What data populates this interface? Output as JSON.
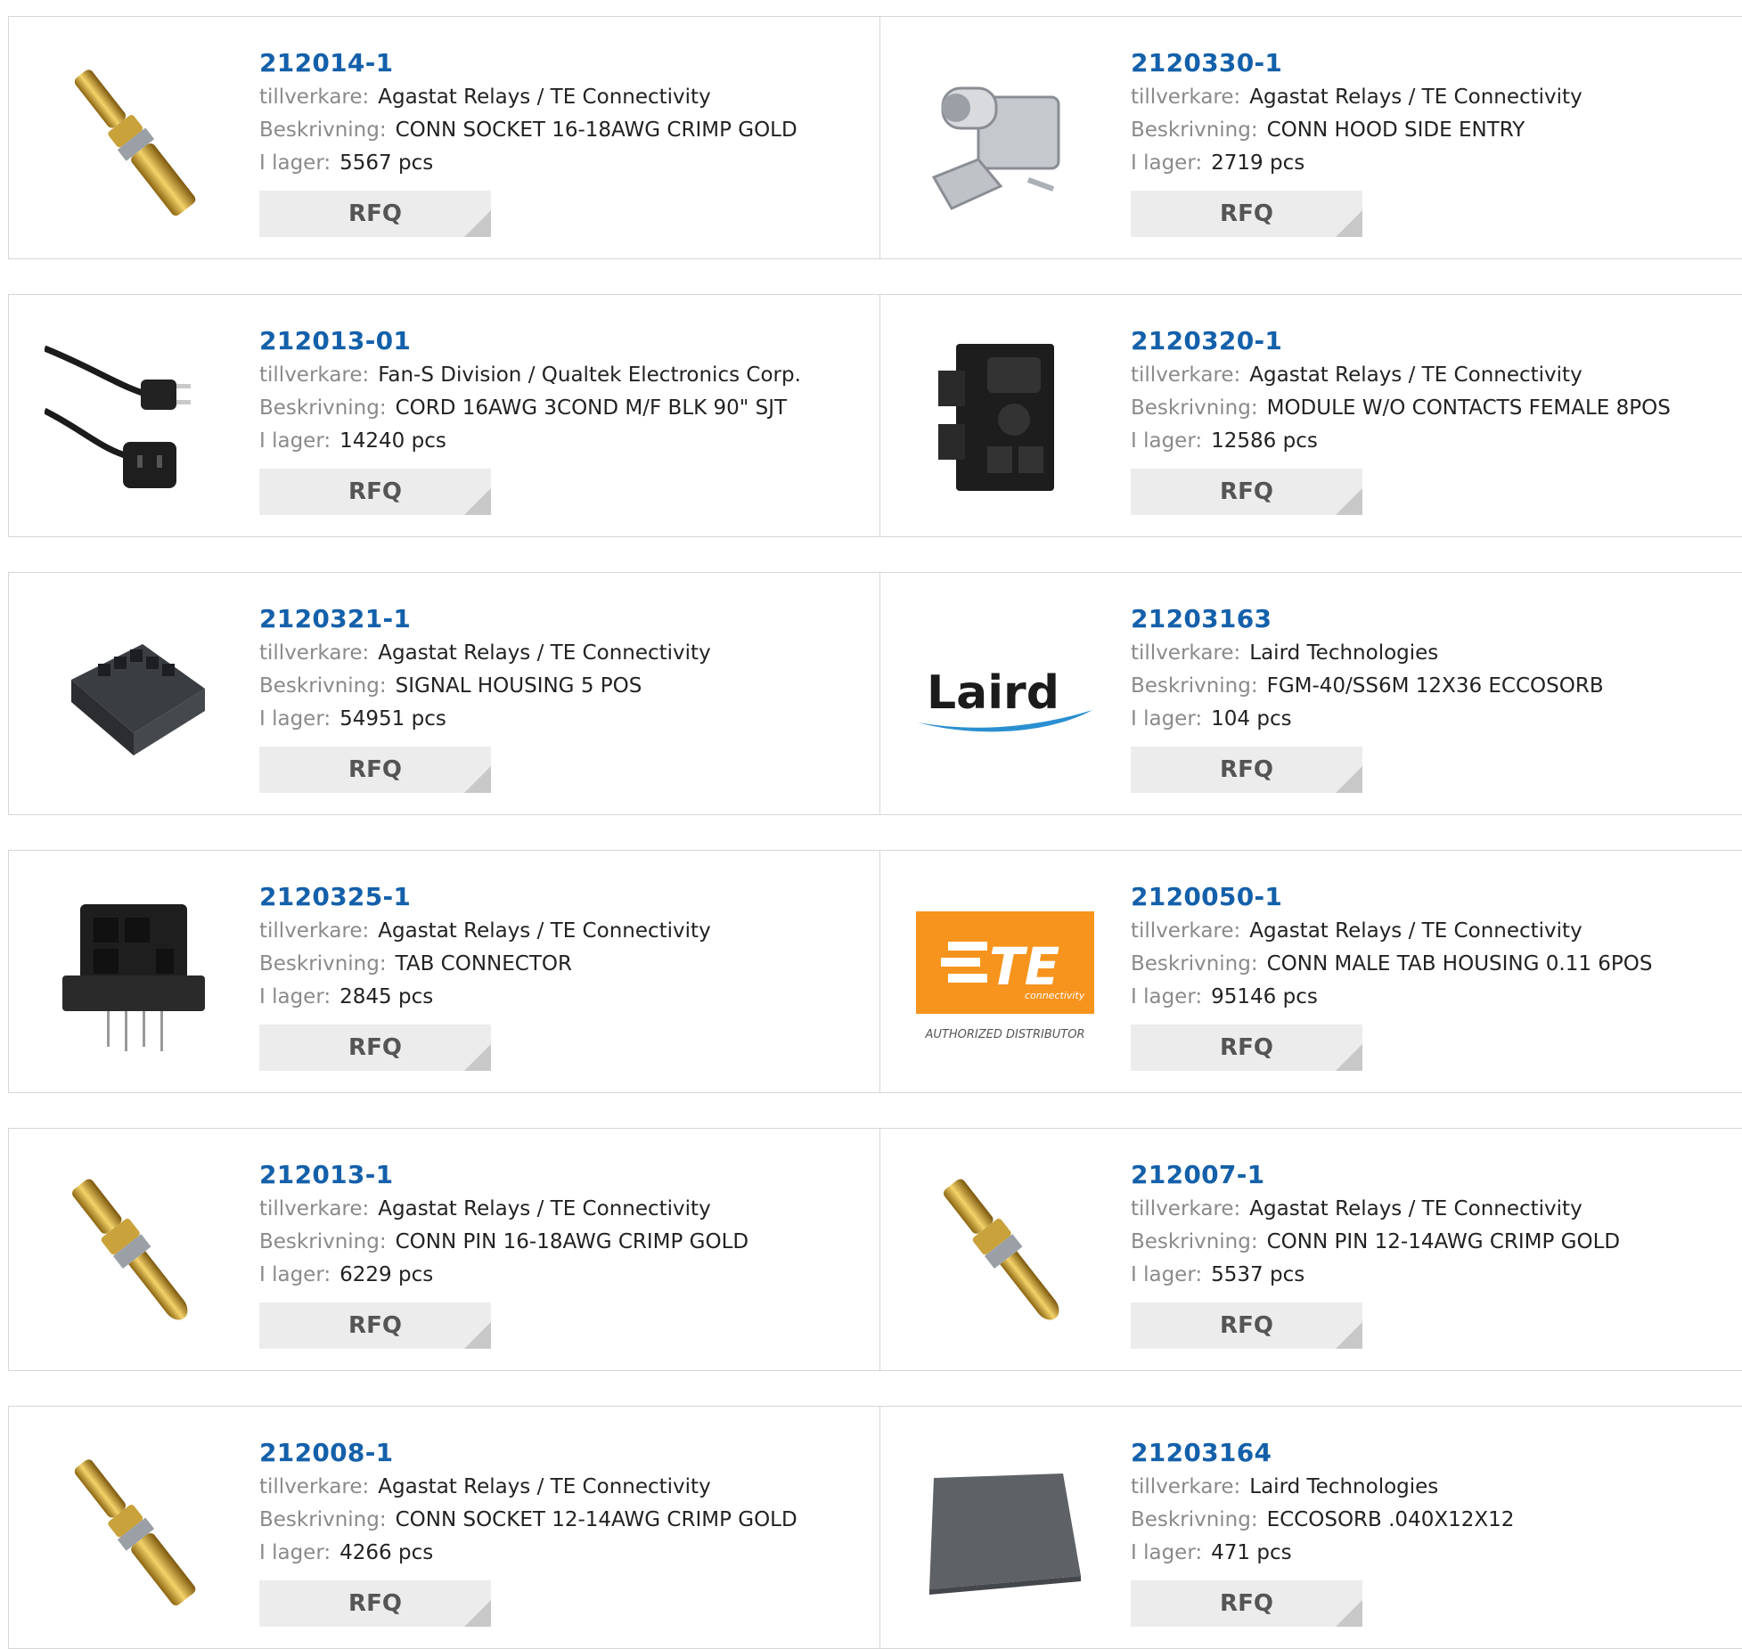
{
  "labels": {
    "manufacturer": "tillverkare:",
    "description": "Beskrivning:",
    "stock": "I lager:",
    "rfq": "RFQ"
  },
  "products": [
    {
      "part": "212014-1",
      "manufacturer": "Agastat Relays / TE Connectivity",
      "description": "CONN SOCKET 16-18AWG CRIMP GOLD",
      "stock": "5567 pcs",
      "image": "gold-socket-contact"
    },
    {
      "part": "2120330-1",
      "manufacturer": "Agastat Relays / TE Connectivity",
      "description": "CONN HOOD SIDE ENTRY",
      "stock": "2719 pcs",
      "image": "metal-hood"
    },
    {
      "part": "212013-01",
      "manufacturer": "Fan-S Division / Qualtek Electronics Corp.",
      "description": "CORD 16AWG 3COND M/F BLK 90\" SJT",
      "stock": "14240 pcs",
      "image": "power-cord"
    },
    {
      "part": "2120320-1",
      "manufacturer": "Agastat Relays / TE Connectivity",
      "description": "MODULE W/O CONTACTS FEMALE 8POS",
      "stock": "12586 pcs",
      "image": "black-module"
    },
    {
      "part": "2120321-1",
      "manufacturer": "Agastat Relays / TE Connectivity",
      "description": "SIGNAL HOUSING 5 POS",
      "stock": "54951 pcs",
      "image": "signal-housing"
    },
    {
      "part": "21203163",
      "manufacturer": "Laird Technologies",
      "description": "FGM-40/SS6M 12X36 ECCOSORB",
      "stock": "104 pcs",
      "image": "laird-logo"
    },
    {
      "part": "2120325-1",
      "manufacturer": "Agastat Relays / TE Connectivity",
      "description": "TAB CONNECTOR",
      "stock": "2845 pcs",
      "image": "tab-connector"
    },
    {
      "part": "2120050-1",
      "manufacturer": "Agastat Relays / TE Connectivity",
      "description": "CONN MALE TAB HOUSING 0.11 6POS",
      "stock": "95146 pcs",
      "image": "te-logo"
    },
    {
      "part": "212013-1",
      "manufacturer": "Agastat Relays / TE Connectivity",
      "description": "CONN PIN 16-18AWG CRIMP GOLD",
      "stock": "6229 pcs",
      "image": "gold-pin-contact"
    },
    {
      "part": "212007-1",
      "manufacturer": "Agastat Relays / TE Connectivity",
      "description": "CONN PIN 12-14AWG CRIMP GOLD",
      "stock": "5537 pcs",
      "image": "gold-pin-contact"
    },
    {
      "part": "212008-1",
      "manufacturer": "Agastat Relays / TE Connectivity",
      "description": "CONN SOCKET 12-14AWG CRIMP GOLD",
      "stock": "4266 pcs",
      "image": "gold-socket-contact"
    },
    {
      "part": "21203164",
      "manufacturer": "Laird Technologies",
      "description": "ECCOSORB .040X12X12",
      "stock": "471 pcs",
      "image": "absorber-sheet"
    }
  ],
  "logos": {
    "laird": "Laird",
    "te": "TE",
    "te_sub": "connectivity",
    "te_badge": "AUTHORIZED DISTRIBUTOR"
  },
  "colors": {
    "part_link": "#1460aa",
    "te_orange": "#f7941d",
    "laird_blue": "#2a8fd0"
  }
}
